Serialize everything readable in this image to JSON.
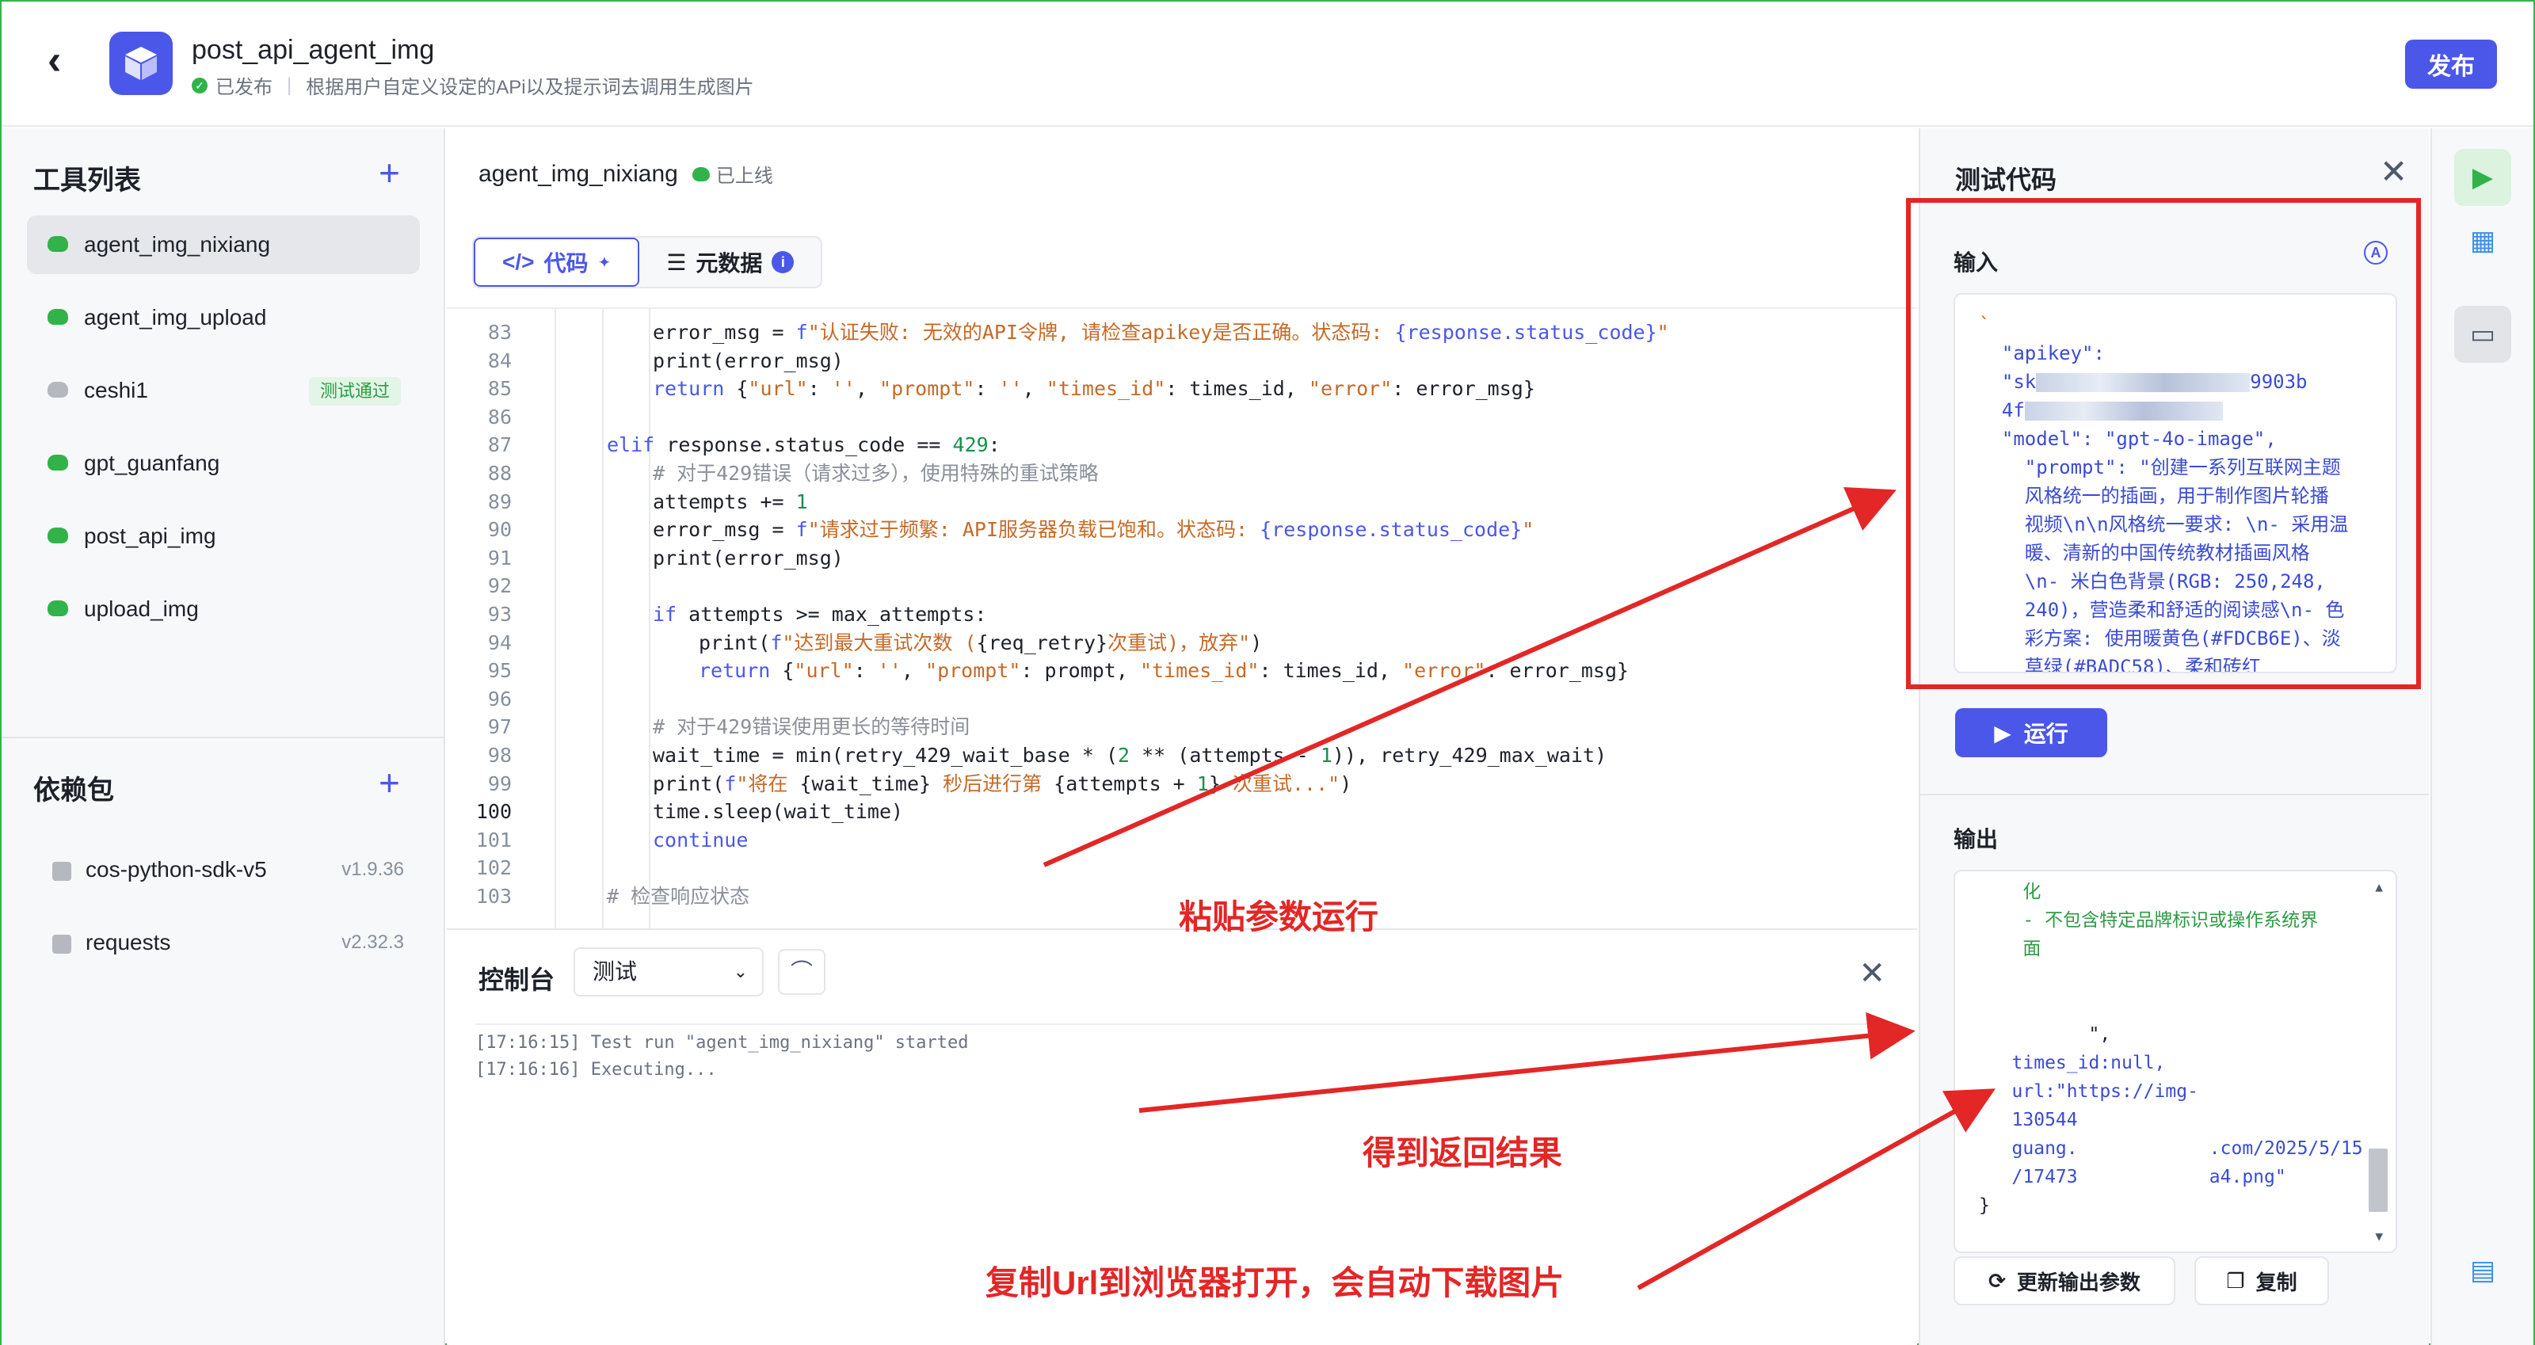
{
  "header": {
    "title": "post_api_agent_img",
    "status": "已发布",
    "description": "根据用户自定义设定的APi以及提示词去调用生成图片",
    "publish_label": "发布"
  },
  "sidebar": {
    "tools_title": "工具列表",
    "tools": [
      {
        "name": "agent_img_nixiang",
        "active": true,
        "badge": ""
      },
      {
        "name": "agent_img_upload",
        "active": false,
        "badge": ""
      },
      {
        "name": "ceshi1",
        "active": false,
        "badge": "测试通过"
      },
      {
        "name": "gpt_guanfang",
        "active": false,
        "badge": ""
      },
      {
        "name": "post_api_img",
        "active": false,
        "badge": ""
      },
      {
        "name": "upload_img",
        "active": false,
        "badge": ""
      }
    ],
    "deps_title": "依赖包",
    "deps": [
      {
        "name": "cos-python-sdk-v5",
        "version": "v1.9.36"
      },
      {
        "name": "requests",
        "version": "v2.32.3"
      }
    ]
  },
  "editor": {
    "tool_name": "agent_img_nixiang",
    "tool_status": "已上线",
    "tab_code": "代码",
    "tab_meta": "元数据",
    "code_lines": [
      {
        "n": "83",
        "indent": 2,
        "html": "error_msg = <span class='k'>f</span><span class='s'>\"认证失败: 无效的API令牌, 请检查apikey是否正确。状态码: </span><span class='k'>{response.status_code}</span><span class='s'>\"</span>"
      },
      {
        "n": "84",
        "indent": 2,
        "html": "print(error_msg)"
      },
      {
        "n": "85",
        "indent": 2,
        "html": "<span class='k'>return</span> {<span class='s'>\"url\"</span>: <span class='s'>''</span>, <span class='s'>\"prompt\"</span>: <span class='s'>''</span>, <span class='s'>\"times_id\"</span>: times_id, <span class='s'>\"error\"</span>: error_msg}"
      },
      {
        "n": "86",
        "indent": 0,
        "html": ""
      },
      {
        "n": "87",
        "indent": 1,
        "html": "<span class='k'>elif</span> response.status_code == <span class='n'>429</span>:"
      },
      {
        "n": "88",
        "indent": 2,
        "html": "<span class='c'># 对于429错误（请求过多），使用特殊的重试策略</span>"
      },
      {
        "n": "89",
        "indent": 2,
        "html": "attempts += <span class='n'>1</span>"
      },
      {
        "n": "90",
        "indent": 2,
        "html": "error_msg = <span class='k'>f</span><span class='s'>\"请求过于频繁: API服务器负载已饱和。状态码: </span><span class='k'>{response.status_code}</span><span class='s'>\"</span>"
      },
      {
        "n": "91",
        "indent": 2,
        "html": "print(error_msg)"
      },
      {
        "n": "92",
        "indent": 0,
        "html": ""
      },
      {
        "n": "93",
        "indent": 2,
        "html": "<span class='k'>if</span> attempts >= max_attempts:"
      },
      {
        "n": "94",
        "indent": 3,
        "html": "print(<span class='k'>f</span><span class='s'>\"达到最大重试次数 (</span>{req_retry}<span class='s'>次重试)，放弃\"</span>)"
      },
      {
        "n": "95",
        "indent": 3,
        "html": "<span class='k'>return</span> {<span class='s'>\"url\"</span>: <span class='s'>''</span>, <span class='s'>\"prompt\"</span>: prompt, <span class='s'>\"times_id\"</span>: times_id, <span class='s'>\"error\"</span>: error_msg}"
      },
      {
        "n": "96",
        "indent": 0,
        "html": ""
      },
      {
        "n": "97",
        "indent": 2,
        "html": "<span class='c'># 对于429错误使用更长的等待时间</span>"
      },
      {
        "n": "98",
        "indent": 2,
        "html": "wait_time = min(retry_429_wait_base * (<span class='n'>2</span> ** (attempts - <span class='n'>1</span>)), retry_429_max_wait)"
      },
      {
        "n": "99",
        "indent": 2,
        "html": "print(<span class='k'>f</span><span class='s'>\"将在 </span>{wait_time}<span class='s'> 秒后进行第 </span>{attempts + <span class='n'>1</span>}<span class='s'> 次重试...\"</span>)"
      },
      {
        "n": "100",
        "indent": 2,
        "html": "time.sleep(wait_time)",
        "current": true
      },
      {
        "n": "101",
        "indent": 2,
        "html": "<span class='k'>continue</span>"
      },
      {
        "n": "102",
        "indent": 0,
        "html": ""
      },
      {
        "n": "103",
        "indent": 1,
        "html": "<span class='c'># 检查响应状态</span>"
      }
    ]
  },
  "console": {
    "title": "控制台",
    "select_value": "测试",
    "logs": [
      "[17:16:15] Test run \"agent_img_nixiang\" started",
      "[17:16:16] Executing..."
    ]
  },
  "test_panel": {
    "title": "测试代码",
    "input_label": "输入",
    "input_lines": [
      "`",
      "  \"apikey\":",
      "  \"sk",
      "  4f",
      "  \"model\": \"gpt-4o-image\",",
      "    \"prompt\": \"创建一系列互联网主题",
      "    风格统一的插画，用于制作图片轮播",
      "    视频\\n\\n风格统一要求: \\n- 采用温",
      "    暖、清新的中国传统教材插画风格",
      "    \\n- 米白色背景(RGB: 250,248,",
      "    240)，营造柔和舒适的阅读感\\n- 色",
      "    彩方案: 使用暖黄色(#FDCB6E)、淡",
      "    草绿(#BADC58)、柔和砖红"
    ],
    "apikey_tail": "9903b",
    "run_label": "运行",
    "output_label": "输出",
    "output_lines": [
      {
        "t": "    化",
        "c": "g"
      },
      {
        "t": "    - 不包含特定品牌标识或操作系统界",
        "c": "g"
      },
      {
        "t": "    面",
        "c": "g"
      },
      {
        "t": "",
        "c": ""
      },
      {
        "t": "",
        "c": ""
      },
      {
        "t": "          \",",
        "c": ""
      },
      {
        "t": "   times_id:null,",
        "c": "b"
      },
      {
        "t": "   url:\"https://img-",
        "c": "b"
      },
      {
        "t": "   130544",
        "c": "b"
      },
      {
        "t": "   guang.            .com/2025/5/15",
        "c": "b"
      },
      {
        "t": "   /17473            a4.png\"",
        "c": "b"
      },
      {
        "t": "}",
        "c": ""
      }
    ],
    "refresh_label": "更新输出参数",
    "copy_label": "复制"
  },
  "annotations": {
    "paste_run": "粘贴参数运行",
    "get_result": "得到返回结果",
    "copy_url": "复制Url到浏览器打开，会自动下载图片"
  },
  "colors": {
    "accent": "#4b57e8",
    "success": "#31b34a",
    "annotation": "#e32626"
  }
}
